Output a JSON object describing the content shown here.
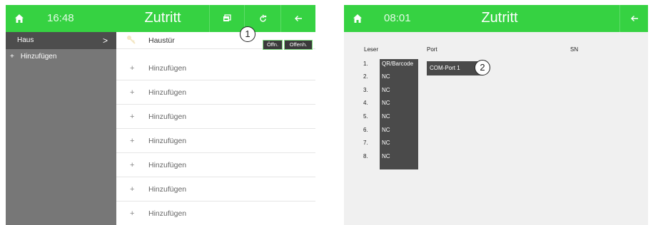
{
  "left": {
    "time": "16:48",
    "title": "Zutritt",
    "sidebar": {
      "selected": "Haus",
      "add_label": "Hinzufügen",
      "plus": "+",
      "chevron": ">"
    },
    "rows": {
      "first_label": "Haustür",
      "open_button": "Öffn.",
      "hold_open_button": "Offenh.",
      "add_label": "Hinzufügen",
      "plus": "+"
    },
    "callout": "1"
  },
  "right": {
    "time": "08:01",
    "title": "Zutritt",
    "headers": {
      "reader": "Leser",
      "port": "Port",
      "sn": "SN"
    },
    "reader_numbers": [
      "1.",
      "2.",
      "3.",
      "4.",
      "5.",
      "6.",
      "7.",
      "8."
    ],
    "reader_values": [
      "QR/Barcode",
      "NC",
      "NC",
      "NC",
      "NC",
      "NC",
      "NC",
      "NC"
    ],
    "port_value": "COM-Port 1",
    "callout": "2"
  },
  "colors": {
    "topbar": "#36d242",
    "sidebar": "#777777",
    "sidebar_selected": "#4d4d4d",
    "dark_cell": "#4a4a4a",
    "right_background": "#f0f0f0"
  },
  "icons": [
    "home-icon",
    "gallery-icon",
    "refresh-icon",
    "back-arrow-icon",
    "key-icon"
  ]
}
